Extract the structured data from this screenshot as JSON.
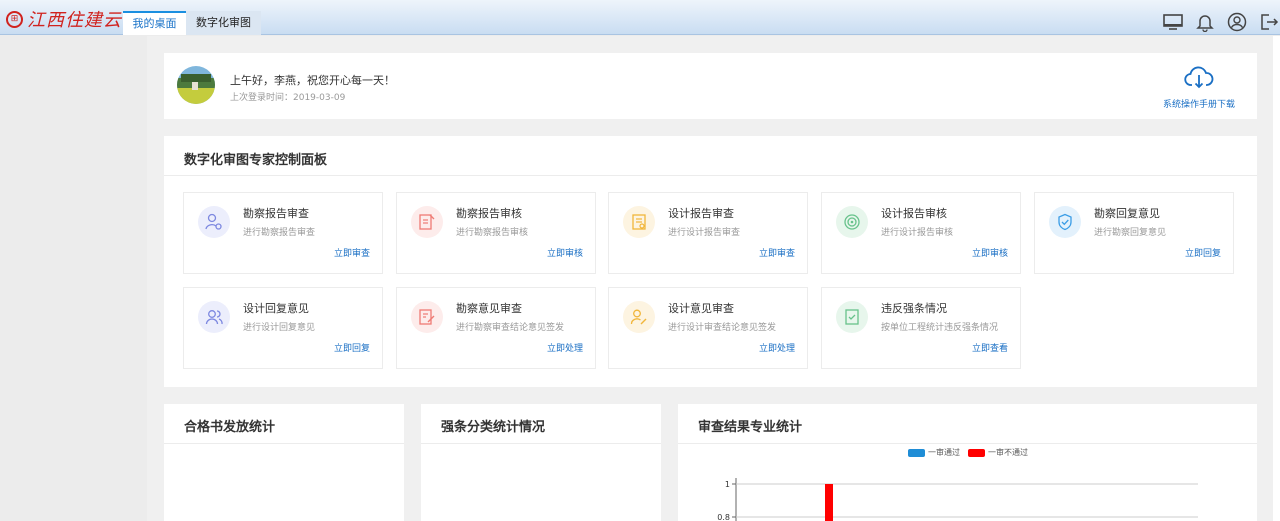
{
  "header": {
    "logo_badge": "⊞",
    "logo_text": "江西住建云",
    "tabs": [
      {
        "label": "我的桌面",
        "active": true
      },
      {
        "label": "数字化审图",
        "active": false
      }
    ],
    "icons": [
      "monitor-icon",
      "bell-icon",
      "user-circle-icon",
      "logout-icon"
    ]
  },
  "welcome": {
    "greeting": "上午好，李燕，祝您开心每一天！",
    "last_login": "上次登录时间：2019-03-09",
    "manual_label": "系统操作手册下载"
  },
  "panel": {
    "title": "数字化审图专家控制面板",
    "tiles": [
      {
        "title": "勘察报告审查",
        "desc": "进行勘察报告审查",
        "link": "立即审查",
        "icon": "user-gear-icon",
        "color": "#7d88e0",
        "bg": "#eceefc"
      },
      {
        "title": "勘察报告审核",
        "desc": "进行勘察报告审核",
        "link": "立即审核",
        "icon": "doc-edit-icon",
        "color": "#ef7b74",
        "bg": "#fdeceb"
      },
      {
        "title": "设计报告审查",
        "desc": "进行设计报告审查",
        "link": "立即审查",
        "icon": "doc-list-icon",
        "color": "#f1b63b",
        "bg": "#fdf4e1"
      },
      {
        "title": "设计报告审核",
        "desc": "进行设计报告审核",
        "link": "立即审核",
        "icon": "target-icon",
        "color": "#67c28b",
        "bg": "#e7f6ec"
      },
      {
        "title": "勘察回复意见",
        "desc": "进行勘察回复意见",
        "link": "立即回复",
        "icon": "shield-check-icon",
        "color": "#3b9de6",
        "bg": "#e3f1fc"
      },
      {
        "title": "设计回复意见",
        "desc": "进行设计回复意见",
        "link": "立即回复",
        "icon": "users-icon",
        "color": "#7d88e0",
        "bg": "#eceefc"
      },
      {
        "title": "勘察意见审查",
        "desc": "进行勘察审查结论意见签发",
        "link": "立即处理",
        "icon": "doc-pen-icon",
        "color": "#ef7b74",
        "bg": "#fdeceb"
      },
      {
        "title": "设计意见审查",
        "desc": "进行设计审查结论意见签发",
        "link": "立即处理",
        "icon": "user-edit-icon",
        "color": "#f1b63b",
        "bg": "#fdf4e1"
      },
      {
        "title": "违反强条情况",
        "desc": "按单位工程统计违反强条情况",
        "link": "立即查看",
        "icon": "doc-check-icon",
        "color": "#67c28b",
        "bg": "#e7f6ec"
      }
    ]
  },
  "cards": {
    "cert_title": "合格书发放统计",
    "mandatory_title": "强条分类统计情况",
    "result_title": "审查结果专业统计"
  },
  "chart_data": {
    "type": "bar",
    "series": [
      {
        "name": "一审通过",
        "color": "#1f8dd6",
        "values": [
          0
        ]
      },
      {
        "name": "一审不通过",
        "color": "#ff0000",
        "values": [
          1
        ]
      }
    ],
    "y_ticks": [
      "1",
      "0.8"
    ],
    "ylim": [
      0,
      1
    ],
    "grid": true,
    "legend": "top-center"
  }
}
